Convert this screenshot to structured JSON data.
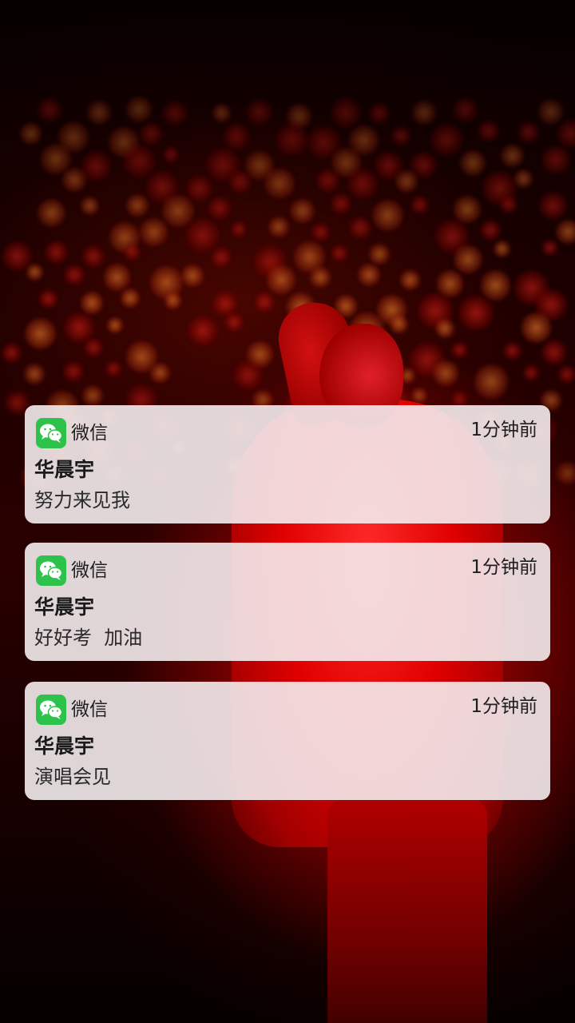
{
  "wallpaper": {
    "description_icon": "concert-performer-wallpaper"
  },
  "colors": {
    "wechat_green": "#2dc24a",
    "card_background": "#f4ecee",
    "wallpaper_red": "#e00000"
  },
  "notifications": [
    {
      "app_icon": "wechat-icon",
      "app_name": "微信",
      "time": "1分钟前",
      "title": "华晨宇",
      "body": "努力来见我"
    },
    {
      "app_icon": "wechat-icon",
      "app_name": "微信",
      "time": "1分钟前",
      "title": "华晨宇",
      "body": "好好考  加油"
    },
    {
      "app_icon": "wechat-icon",
      "app_name": "微信",
      "time": "1分钟前",
      "title": "华晨宇",
      "body": "演唱会见"
    }
  ]
}
